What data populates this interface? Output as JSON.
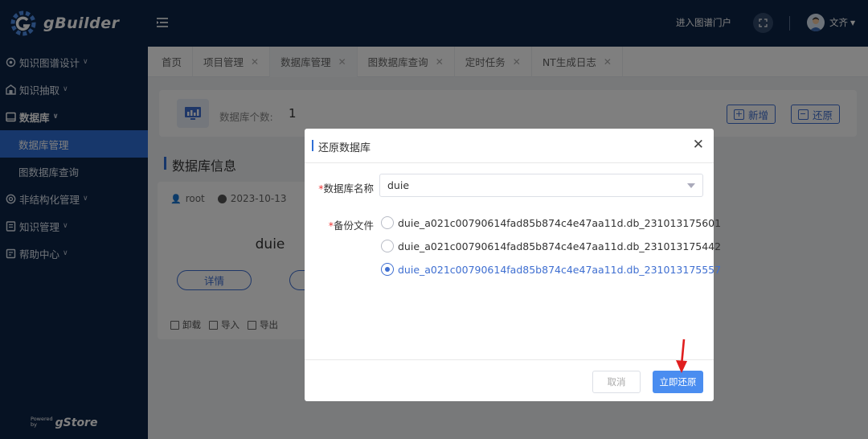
{
  "app": {
    "brand": "gBuilder",
    "powered_prefix": "Powered\nby",
    "powered_brand": "gStore"
  },
  "sidebar": {
    "items": [
      {
        "label": "知识图谱设计",
        "icon": "graph-design-icon"
      },
      {
        "label": "知识抽取",
        "icon": "extract-icon"
      },
      {
        "label": "数据库",
        "icon": "database-icon"
      },
      {
        "label": "非结构化管理",
        "icon": "unstructured-icon"
      },
      {
        "label": "知识管理",
        "icon": "knowledge-icon"
      },
      {
        "label": "帮助中心",
        "icon": "help-icon"
      }
    ],
    "sub_items": [
      {
        "label": "数据库管理",
        "active": true
      },
      {
        "label": "图数据库查询",
        "active": false
      }
    ]
  },
  "header": {
    "portal_link": "进入图谱门户",
    "user_name": "文齐"
  },
  "tabs": [
    {
      "label": "首页",
      "closable": false
    },
    {
      "label": "项目管理",
      "closable": true
    },
    {
      "label": "数据库管理",
      "closable": true,
      "active": true
    },
    {
      "label": "图数据库查询",
      "closable": true
    },
    {
      "label": "定时任务",
      "closable": true
    },
    {
      "label": "NT生成日志",
      "closable": true
    }
  ],
  "summary": {
    "count_label": "数据库个数:",
    "count_value": "1",
    "add_label": "新增",
    "restore_label": "还原"
  },
  "section_title": "数据库信息",
  "card": {
    "owner": "root",
    "date": "2023-10-13",
    "name": "duie",
    "detail_label": "详情",
    "actions": [
      "卸载",
      "导入",
      "导出"
    ]
  },
  "modal": {
    "title": "还原数据库",
    "db_name_label": "数据库名称",
    "db_name_value": "duie",
    "backup_label": "备份文件",
    "backup_files": [
      {
        "name": "duie_a021c00790614fad85b874c4e47aa11d.db_231013175601",
        "checked": false
      },
      {
        "name": "duie_a021c00790614fad85b874c4e47aa11d.db_231013175442",
        "checked": false
      },
      {
        "name": "duie_a021c00790614fad85b874c4e47aa11d.db_231013175557",
        "checked": true
      }
    ],
    "cancel_label": "取消",
    "confirm_label": "立即还原"
  },
  "colors": {
    "sidebar_bg": "#0c2447",
    "accent": "#2f6fd6",
    "primary_button": "#4a8df0",
    "annotation_arrow": "#e01e1e"
  }
}
